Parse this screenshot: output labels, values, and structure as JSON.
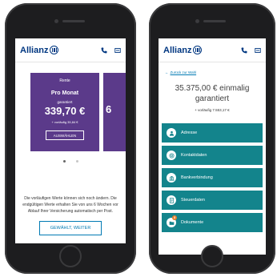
{
  "header": {
    "logo": "Allianz"
  },
  "left_screen": {
    "card": {
      "tag": "Rente",
      "name": "Pro Monat",
      "guarantee": "garantiert",
      "price": "339,70 €",
      "note": "+ vorläufig 35,84 €",
      "button": "AUSWÄHLEN"
    },
    "next_card_peek": "6",
    "info_text": "Die vorläufigen Werte können sich noch ändern. Die endgültigen Werte erhalten Sie von uns 6 Wochen vor Ablauf Ihrer Versicherung automatisch per Post.",
    "choose_button": "GEWÄHLT, WEITER"
  },
  "right_screen": {
    "back_link": "Zurück zur Wahl",
    "amount": "35.375,00 € einmalig garantiert",
    "amount_note": "+ vorläufig 7.553,17 €",
    "menu": [
      {
        "label": "Adresse",
        "icon": "person-icon"
      },
      {
        "label": "Kontaktdaten",
        "icon": "at-sign-icon"
      },
      {
        "label": "Bankverbindung",
        "icon": "bank-icon"
      },
      {
        "label": "Steuerdaten",
        "icon": "tax-icon"
      },
      {
        "label": "Dokumente",
        "icon": "document-icon",
        "badge": "3"
      }
    ]
  },
  "colors": {
    "brand": "#003781",
    "card": "#5b3a8a",
    "menu": "#13848c",
    "link": "#007ab3",
    "badge": "#e67f2c"
  }
}
